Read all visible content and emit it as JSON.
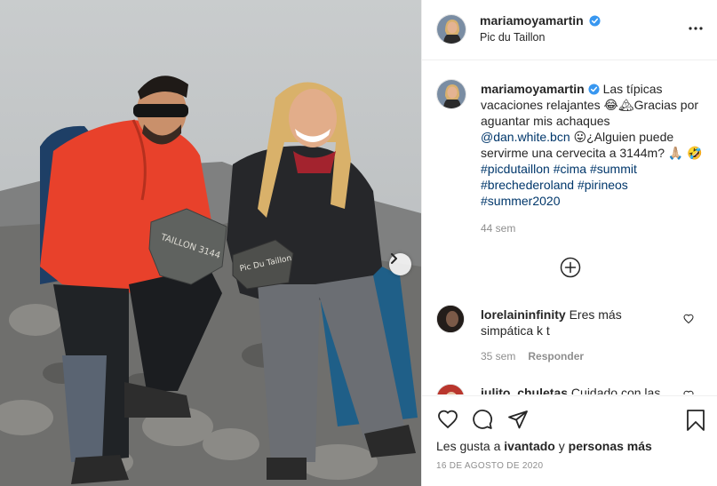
{
  "post": {
    "username": "mariamoyamartin",
    "location": "Pic du Taillon",
    "verified": true
  },
  "photo": {
    "rock_left_text": "TAILLON 3144",
    "rock_right_text": "Pic Du Taillon",
    "next_icon": "chevron-right-icon"
  },
  "caption": {
    "username": "mariamoyamartin",
    "text_1": "Las típicas vacaciones relajantes 😂🏔Gracias por aguantar mis achaques ",
    "mention": "@dan.white.bcn",
    "text_2": " 😛¿Alguien puede servirme una cervecita a 3144m? 🙏🏼",
    "text_3": "🤣",
    "hashtags": [
      "#picdutaillon",
      "#cima",
      "#summit",
      "#brechederoland",
      "#pirineos",
      "#summer2020"
    ],
    "time": "44 sem"
  },
  "comments": [
    {
      "username": "lorelaininfinity",
      "text": "Eres más simpática k t",
      "time": "35 sem",
      "reply": "Responder"
    },
    {
      "username": "julito_chuletas",
      "text": "Cuidado con las"
    }
  ],
  "likes": {
    "prefix": "Les gusta a ",
    "user": "ivantado",
    "middle": " y ",
    "others": "personas más"
  },
  "date": "16 de agosto de 2020",
  "colors": {
    "verified_blue": "#3897f0",
    "link": "#00376b",
    "muted": "#8e8e8e",
    "border": "#efefef"
  }
}
